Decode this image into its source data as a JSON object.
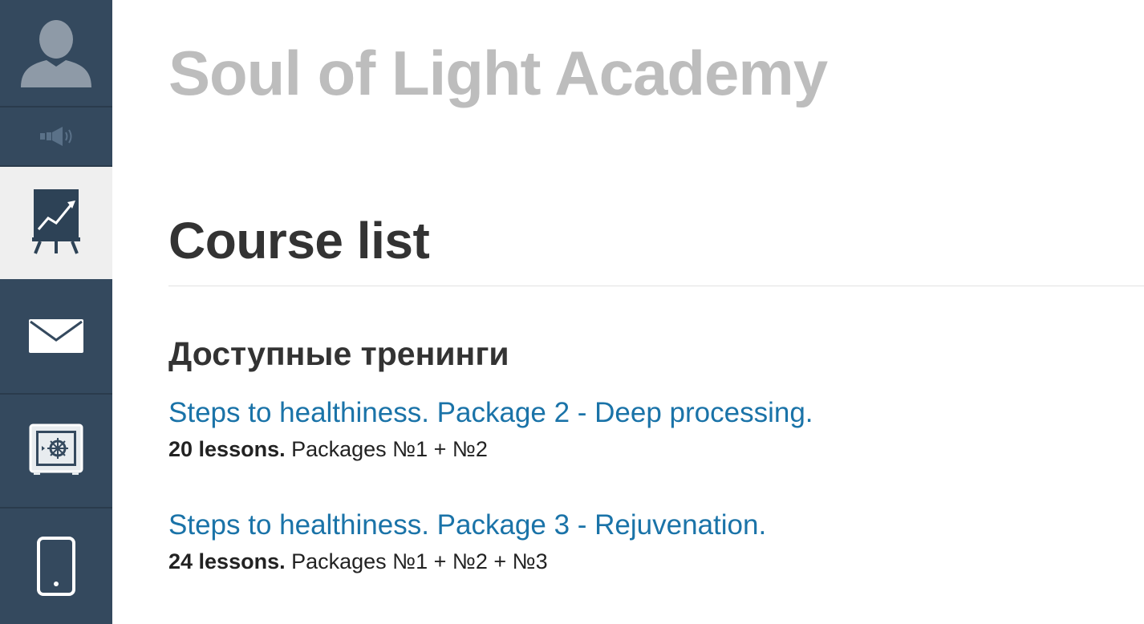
{
  "app": {
    "title": "Soul of Light Academy"
  },
  "sidebar": {
    "items": [
      {
        "name": "profile",
        "icon": "user-avatar-icon"
      },
      {
        "name": "sound",
        "icon": "speaker-icon"
      },
      {
        "name": "courses",
        "icon": "presentation-chart-icon",
        "active": true
      },
      {
        "name": "messages",
        "icon": "envelope-icon"
      },
      {
        "name": "safe",
        "icon": "safe-icon"
      },
      {
        "name": "mobile",
        "icon": "phone-icon"
      }
    ]
  },
  "page": {
    "title": "Course list"
  },
  "section": {
    "title": "Доступные тренинги"
  },
  "courses": [
    {
      "title": "Steps to healthiness. Package 2 - Deep processing.",
      "lessons": "20 lessons.",
      "packages": "Packages №1 + №2"
    },
    {
      "title": "Steps to healthiness. Package 3 - Rejuvenation.",
      "lessons": "24 lessons.",
      "packages": "Packages №1 + №2 + №3"
    }
  ],
  "colors": {
    "sidebar_bg": "#34495e",
    "sidebar_active_bg": "#efefef",
    "link": "#1a73a8",
    "title_grey": "#bdbdbd",
    "text_dark": "#333333"
  }
}
